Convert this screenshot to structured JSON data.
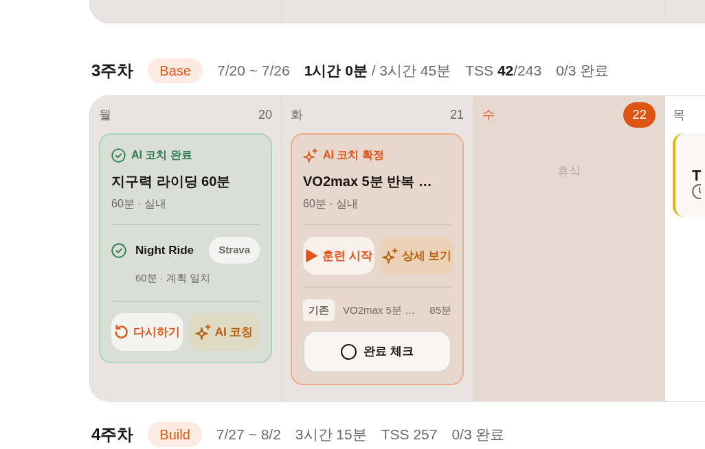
{
  "weeks": [
    {
      "header": {
        "week": "3주차",
        "phase": "Base",
        "dates": "7/20 ~ 7/26",
        "time": "**1시간 0분** / 3시간 45분",
        "tss": "TSS **42**/243",
        "progress": "0/3 완료"
      },
      "days": [
        {
          "weekday": "월",
          "date": "20",
          "past": true,
          "today": false,
          "workouts": [
            {
              "kind": "completed",
              "status": "AI 코치 완료",
              "title": "지구력 라이딩 60분",
              "meta": "60분 · 실내",
              "activity": {
                "name": "Night Ride",
                "source": "Strava",
                "meta": "60분 · 계획 일치"
              },
              "actions": [
                {
                  "kind": "retry",
                  "label": "다시하기"
                },
                {
                  "kind": "coach",
                  "label": "AI 코칭"
                }
              ]
            }
          ]
        },
        {
          "weekday": "화",
          "date": "21",
          "past": true,
          "today": false,
          "workouts": [
            {
              "kind": "confirmed",
              "status": "AI 코치 확정",
              "title": "VO2max 5분 반복 …",
              "meta": "60분 · 실내",
              "actions": [
                {
                  "kind": "start",
                  "label": "훈련 시작"
                },
                {
                  "kind": "detail",
                  "label": "상세 보기"
                }
              ],
              "original": {
                "tag": "기존",
                "title": "VO2max 5분 …",
                "duration": "85분"
              },
              "complete": {
                "label": "완료 체크",
                "checked": false
              }
            }
          ]
        },
        {
          "weekday": "수",
          "date": "22",
          "past": false,
          "today": true,
          "rest": "휴식"
        },
        {
          "weekday": "목",
          "past": false,
          "today": false,
          "workouts": [
            {
              "kind": "scheduled",
              "title": "T"
            }
          ]
        }
      ]
    },
    {
      "header": {
        "week": "4주차",
        "phase": "Build",
        "dates": "7/27 ~ 8/2",
        "time": "3시간 15분",
        "tss": "TSS 257",
        "progress": "0/3 완료"
      }
    }
  ]
}
